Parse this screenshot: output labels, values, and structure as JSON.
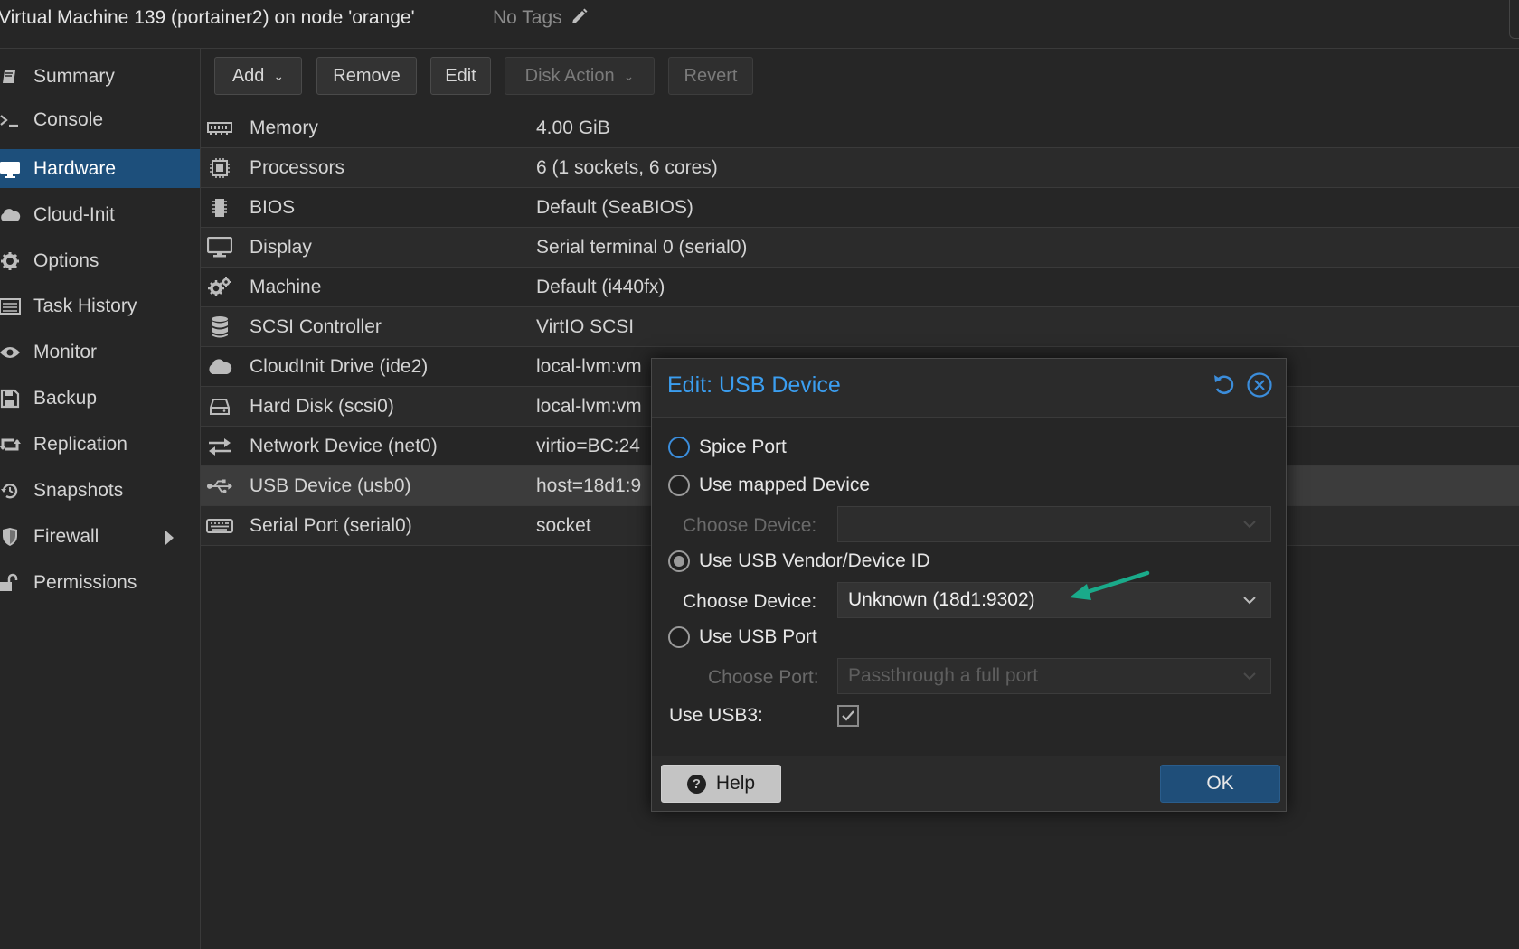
{
  "header": {
    "title": "Virtual Machine 139 (portainer2) on node 'orange'",
    "tags_label": "No Tags"
  },
  "sidebar": {
    "items": [
      {
        "label": "Summary",
        "icon": "book-icon"
      },
      {
        "label": "Console",
        "icon": "terminal-icon"
      },
      {
        "label": "Hardware",
        "icon": "desktop-icon",
        "active": true
      },
      {
        "label": "Cloud-Init",
        "icon": "cloud-icon"
      },
      {
        "label": "Options",
        "icon": "gear-icon"
      },
      {
        "label": "Task History",
        "icon": "list-icon"
      },
      {
        "label": "Monitor",
        "icon": "eye-icon"
      },
      {
        "label": "Backup",
        "icon": "floppy-icon"
      },
      {
        "label": "Replication",
        "icon": "retweet-icon"
      },
      {
        "label": "Snapshots",
        "icon": "history-icon"
      },
      {
        "label": "Firewall",
        "icon": "shield-icon"
      },
      {
        "label": "Permissions",
        "icon": "unlock-icon"
      }
    ]
  },
  "toolbar": {
    "add": "Add",
    "remove": "Remove",
    "edit": "Edit",
    "disk_action": "Disk Action",
    "revert": "Revert"
  },
  "hardware": {
    "rows": [
      {
        "key": "Memory",
        "value": "4.00 GiB",
        "icon": "memory-icon"
      },
      {
        "key": "Processors",
        "value": "6 (1 sockets, 6 cores)",
        "icon": "cpu-icon"
      },
      {
        "key": "BIOS",
        "value": "Default (SeaBIOS)",
        "icon": "chip-icon"
      },
      {
        "key": "Display",
        "value": "Serial terminal 0 (serial0)",
        "icon": "monitor-icon"
      },
      {
        "key": "Machine",
        "value": "Default (i440fx)",
        "icon": "cogs-icon"
      },
      {
        "key": "SCSI Controller",
        "value": "VirtIO SCSI",
        "icon": "database-icon"
      },
      {
        "key": "CloudInit Drive (ide2)",
        "value": "local-lvm:vm",
        "icon": "cloud-icon"
      },
      {
        "key": "Hard Disk (scsi0)",
        "value": "local-lvm:vm",
        "icon": "hdd-icon"
      },
      {
        "key": "Network Device (net0)",
        "value": "virtio=BC:24",
        "icon": "exchange-icon"
      },
      {
        "key": "USB Device (usb0)",
        "value": "host=18d1:9",
        "icon": "usb-icon"
      },
      {
        "key": "Serial Port (serial0)",
        "value": "socket",
        "icon": "keyboard-icon"
      }
    ]
  },
  "dialog": {
    "title": "Edit: USB Device",
    "option_spice": "Spice Port",
    "option_mapped": "Use mapped Device",
    "mapped_label": "Choose Device:",
    "mapped_value": "",
    "option_vendor": "Use USB Vendor/Device ID",
    "vendor_label": "Choose Device:",
    "vendor_value": "Unknown (18d1:9302)",
    "option_port": "Use USB Port",
    "port_label": "Choose Port:",
    "port_placeholder": "Passthrough a full port",
    "usb3_label": "Use USB3:",
    "usb3_checked": true,
    "selected_option": "Use USB Vendor/Device ID",
    "help": "Help",
    "ok": "OK"
  },
  "colors": {
    "accent": "#1d4f7b",
    "dialog_title": "#3b9ef0",
    "annotation_arrow": "#1aaa8a"
  }
}
